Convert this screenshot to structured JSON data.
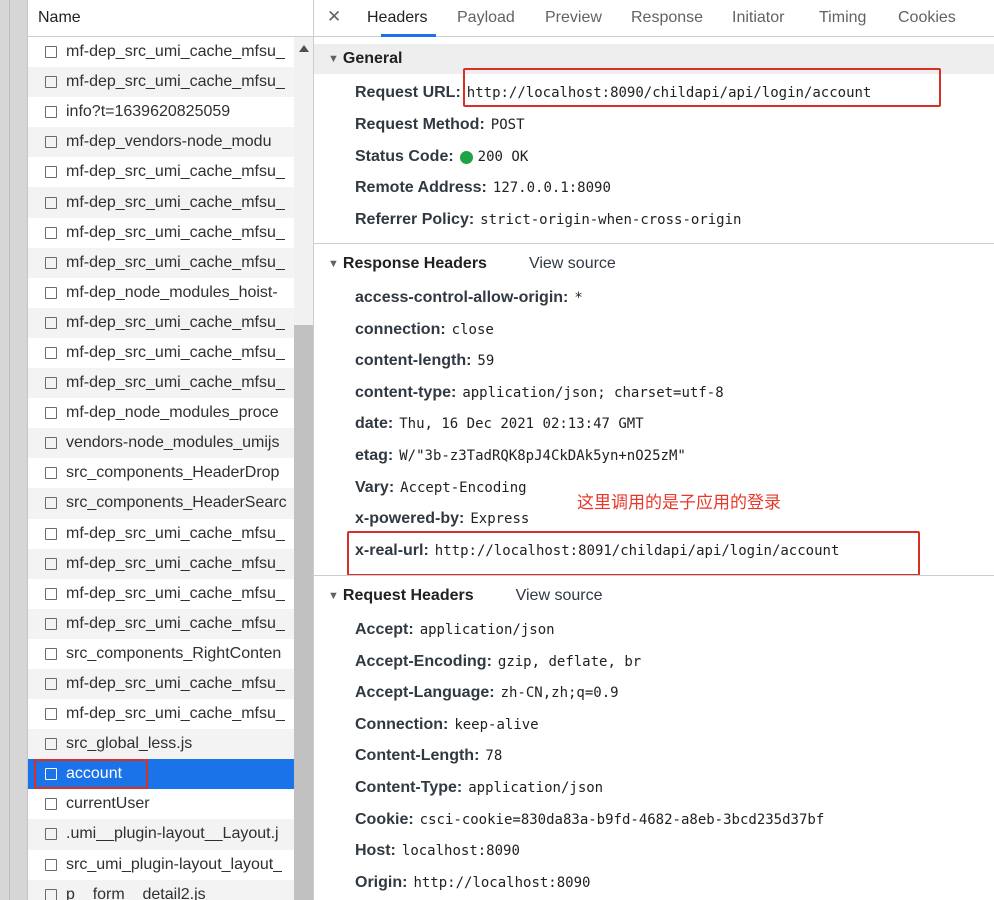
{
  "requests": {
    "column_header": "Name",
    "items": [
      "mf-dep_src_umi_cache_mfsu_",
      "mf-dep_src_umi_cache_mfsu_",
      "info?t=1639620825059",
      "mf-dep_vendors-node_modu",
      "mf-dep_src_umi_cache_mfsu_",
      "mf-dep_src_umi_cache_mfsu_",
      "mf-dep_src_umi_cache_mfsu_",
      "mf-dep_src_umi_cache_mfsu_",
      "mf-dep_node_modules_hoist-",
      "mf-dep_src_umi_cache_mfsu_",
      "mf-dep_src_umi_cache_mfsu_",
      "mf-dep_src_umi_cache_mfsu_",
      "mf-dep_node_modules_proce",
      "vendors-node_modules_umijs",
      "src_components_HeaderDrop",
      "src_components_HeaderSearc",
      "mf-dep_src_umi_cache_mfsu_",
      "mf-dep_src_umi_cache_mfsu_",
      "mf-dep_src_umi_cache_mfsu_",
      "mf-dep_src_umi_cache_mfsu_",
      "src_components_RightConten",
      "mf-dep_src_umi_cache_mfsu_",
      "mf-dep_src_umi_cache_mfsu_",
      "src_global_less.js",
      "account",
      "currentUser",
      ".umi__plugin-layout__Layout.j",
      "src_umi_plugin-layout_layout_",
      "p__form__detail2.js"
    ]
  },
  "tabs": {
    "headers": "Headers",
    "payload": "Payload",
    "preview": "Preview",
    "response": "Response",
    "initiator": "Initiator",
    "timing": "Timing",
    "cookies": "Cookies"
  },
  "general": {
    "title": "General",
    "request_url_key": "Request URL:",
    "request_url": "http://localhost:8090/childapi/api/login/account",
    "method_key": "Request Method:",
    "method": "POST",
    "status_key": "Status Code:",
    "status": "200 OK",
    "status_color": "#1ea446",
    "remote_key": "Remote Address:",
    "remote": "127.0.0.1:8090",
    "referrer_key": "Referrer Policy:",
    "referrer": "strict-origin-when-cross-origin"
  },
  "response_headers": {
    "title": "Response Headers",
    "view_source": "View source",
    "items": [
      {
        "k": "access-control-allow-origin:",
        "v": "*"
      },
      {
        "k": "connection:",
        "v": "close"
      },
      {
        "k": "content-length:",
        "v": "59"
      },
      {
        "k": "content-type:",
        "v": "application/json; charset=utf-8"
      },
      {
        "k": "date:",
        "v": "Thu, 16 Dec 2021 02:13:47 GMT"
      },
      {
        "k": "etag:",
        "v": "W/\"3b-z3TadRQK8pJ4CkDAk5yn+nO25zM\""
      },
      {
        "k": "Vary:",
        "v": "Accept-Encoding"
      },
      {
        "k": "x-powered-by:",
        "v": "Express"
      },
      {
        "k": "x-real-url:",
        "v": "http://localhost:8091/childapi/api/login/account"
      }
    ]
  },
  "annotation": "这里调用的是子应用的登录",
  "request_headers": {
    "title": "Request Headers",
    "view_source": "View source",
    "items": [
      {
        "k": "Accept:",
        "v": "application/json"
      },
      {
        "k": "Accept-Encoding:",
        "v": "gzip, deflate, br"
      },
      {
        "k": "Accept-Language:",
        "v": "zh-CN,zh;q=0.9"
      },
      {
        "k": "Connection:",
        "v": "keep-alive"
      },
      {
        "k": "Content-Length:",
        "v": "78"
      },
      {
        "k": "Content-Type:",
        "v": "application/json"
      },
      {
        "k": "Cookie:",
        "v": "csci-cookie=830da83a-b9fd-4682-a8eb-3bcd235d37bf"
      },
      {
        "k": "Host:",
        "v": "localhost:8090"
      },
      {
        "k": "Origin:",
        "v": "http://localhost:8090"
      }
    ]
  },
  "colors": {
    "selected_row": "#1a73e8",
    "highlight_box": "#d93025",
    "annotation": "#e8382b"
  }
}
